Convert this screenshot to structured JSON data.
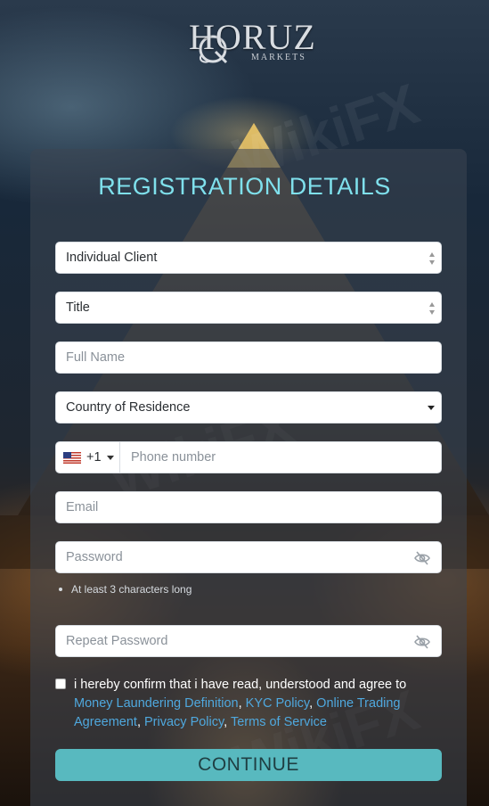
{
  "brand": {
    "name": "HORUZ",
    "sub": "MARKETS"
  },
  "form": {
    "title": "REGISTRATION DETAILS",
    "account_type": "Individual Client",
    "title_select": "Title",
    "full_name_placeholder": "Full Name",
    "country": "Country of Residence",
    "phone_code": "+1",
    "phone_placeholder": "Phone number",
    "email_placeholder": "Email",
    "password_placeholder": "Password",
    "password_hint": "At least 3 characters long",
    "repeat_password_placeholder": "Repeat Password",
    "agree_text": "i hereby confirm that i have read, understood and agree to",
    "links": [
      "Money Laundering Definition",
      "KYC Policy",
      "Online Trading Agreement",
      "Privacy Policy",
      "Terms of Service"
    ],
    "continue_label": "CONTINUE"
  },
  "colors": {
    "title": "#7fe0ec",
    "link": "#4fa8de",
    "button": "#58b9bf"
  },
  "icons": {
    "phone_flag": "us-flag-icon",
    "password_toggle": "eye-off-icon"
  }
}
